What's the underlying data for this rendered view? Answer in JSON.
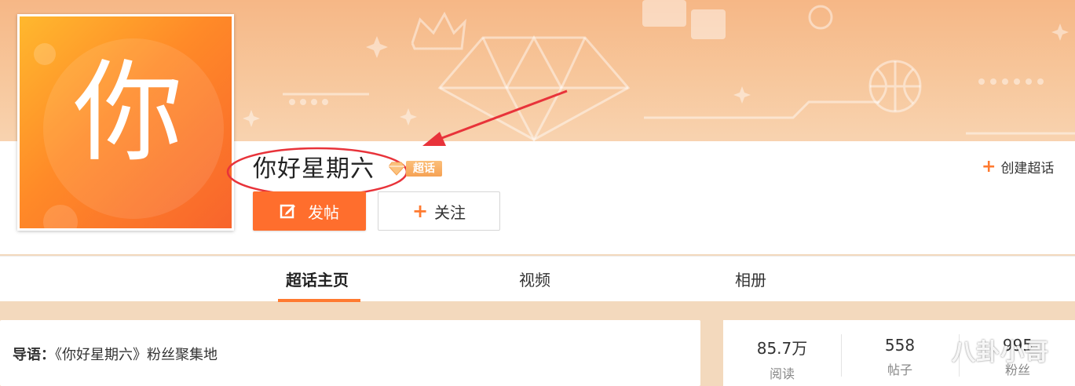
{
  "avatar": {
    "char": "你"
  },
  "topic": {
    "name": "你好星期六",
    "badge_label": "超话"
  },
  "actions": {
    "post_label": "发帖",
    "follow_label": "关注",
    "create_label": "创建超话"
  },
  "tabs": [
    {
      "label": "超话主页",
      "active": true
    },
    {
      "label": "视频",
      "active": false
    },
    {
      "label": "相册",
      "active": false
    }
  ],
  "intro": {
    "prefix": "导语：",
    "text": "《你好星期六》粉丝聚集地"
  },
  "stats": [
    {
      "value": "85.7万",
      "label": "阅读"
    },
    {
      "value": "558",
      "label": "帖子"
    },
    {
      "value": "995",
      "label": "粉丝"
    }
  ],
  "watermark": "八卦小哥",
  "colors": {
    "accent": "#ff7a30",
    "annotation": "#e8333a"
  },
  "icons": {
    "edit": "edit-icon",
    "gem": "gem-icon",
    "plus": "plus-icon"
  }
}
